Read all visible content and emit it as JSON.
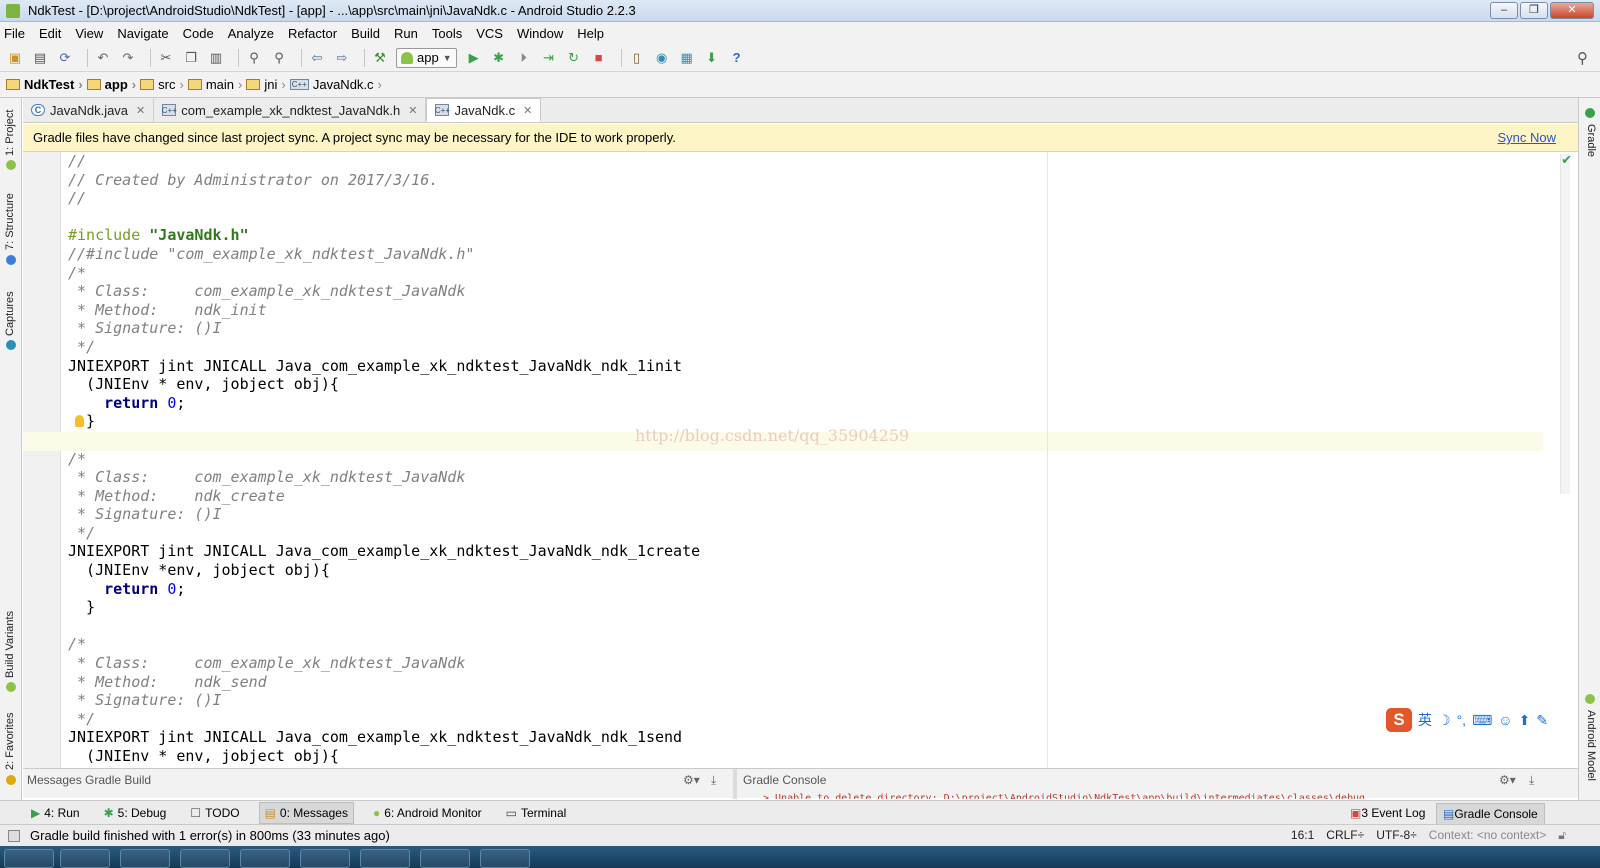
{
  "window": {
    "title": "NdkTest - [D:\\project\\AndroidStudio\\NdkTest] - [app] - ...\\app\\src\\main\\jni\\JavaNdk.c - Android Studio 2.2.3"
  },
  "menu": [
    "File",
    "Edit",
    "View",
    "Navigate",
    "Code",
    "Analyze",
    "Refactor",
    "Build",
    "Run",
    "Tools",
    "VCS",
    "Window",
    "Help"
  ],
  "toolbar": {
    "run_config": "app"
  },
  "breadcrumbs": [
    "NdkTest",
    "app",
    "src",
    "main",
    "jni",
    "JavaNdk.c"
  ],
  "left_tools": [
    "1: Project",
    "7: Structure",
    "Captures",
    "Build Variants",
    "2: Favorites"
  ],
  "right_tools": [
    "Gradle",
    "Android Model"
  ],
  "tabs": [
    {
      "label": "JavaNdk.java",
      "type": "java"
    },
    {
      "label": "com_example_xk_ndktest_JavaNdk.h",
      "type": "c"
    },
    {
      "label": "JavaNdk.c",
      "type": "c"
    }
  ],
  "notification": {
    "text": "Gradle files have changed since last project sync. A project sync may be necessary for the IDE to work properly.",
    "action": "Sync Now"
  },
  "code_lines": [
    [
      [
        "c-comment",
        "//"
      ]
    ],
    [
      [
        "c-comment",
        "// Created by Administrator on 2017/3/16."
      ]
    ],
    [
      [
        "c-comment",
        "//"
      ]
    ],
    [
      [
        "c-plain",
        ""
      ]
    ],
    [
      [
        "c-pre",
        "#include "
      ],
      [
        "c-str",
        "\"JavaNdk.h\""
      ]
    ],
    [
      [
        "c-comment",
        "//#include \"com_example_xk_ndktest_JavaNdk.h\""
      ]
    ],
    [
      [
        "c-comment",
        "/*"
      ]
    ],
    [
      [
        "c-comment",
        " * Class:     com_example_xk_ndktest_JavaNdk"
      ]
    ],
    [
      [
        "c-comment",
        " * Method:    ndk_init"
      ]
    ],
    [
      [
        "c-comment",
        " * Signature: ()I"
      ]
    ],
    [
      [
        "c-comment",
        " */"
      ]
    ],
    [
      [
        "c-plain",
        "JNIEXPORT jint JNICALL Java_com_example_xk_ndktest_JavaNdk_ndk_1init"
      ]
    ],
    [
      [
        "c-plain",
        "  (JNIEnv * env, jobject obj){"
      ]
    ],
    [
      [
        "c-plain",
        "    "
      ],
      [
        "c-kw",
        "return "
      ],
      [
        "c-num",
        "0"
      ],
      [
        "c-plain",
        ";"
      ]
    ],
    [
      [
        "c-plain",
        "  }"
      ]
    ],
    [
      [
        "c-plain",
        ""
      ]
    ],
    [
      [
        "c-comment",
        "/*"
      ]
    ],
    [
      [
        "c-comment",
        " * Class:     com_example_xk_ndktest_JavaNdk"
      ]
    ],
    [
      [
        "c-comment",
        " * Method:    ndk_create"
      ]
    ],
    [
      [
        "c-comment",
        " * Signature: ()I"
      ]
    ],
    [
      [
        "c-comment",
        " */"
      ]
    ],
    [
      [
        "c-plain",
        "JNIEXPORT jint JNICALL Java_com_example_xk_ndktest_JavaNdk_ndk_1create"
      ]
    ],
    [
      [
        "c-plain",
        "  (JNIEnv *env, jobject obj){"
      ]
    ],
    [
      [
        "c-plain",
        "    "
      ],
      [
        "c-kw",
        "return "
      ],
      [
        "c-num",
        "0"
      ],
      [
        "c-plain",
        ";"
      ]
    ],
    [
      [
        "c-plain",
        "  }"
      ]
    ],
    [
      [
        "c-plain",
        ""
      ]
    ],
    [
      [
        "c-comment",
        "/*"
      ]
    ],
    [
      [
        "c-comment",
        " * Class:     com_example_xk_ndktest_JavaNdk"
      ]
    ],
    [
      [
        "c-comment",
        " * Method:    ndk_send"
      ]
    ],
    [
      [
        "c-comment",
        " * Signature: ()I"
      ]
    ],
    [
      [
        "c-comment",
        " */"
      ]
    ],
    [
      [
        "c-plain",
        "JNIEXPORT jint JNICALL Java_com_example_xk_ndktest_JavaNdk_ndk_1send"
      ]
    ],
    [
      [
        "c-plain",
        "  (JNIEnv * env, jobject obj){"
      ]
    ]
  ],
  "watermark": "http://blog.csdn.net/qq_35904259",
  "ime": {
    "label": "英"
  },
  "panels": {
    "messages": "Messages Gradle Build",
    "gradle_console": "Gradle Console",
    "console_error": "> Unable to delete directory: D:\\project\\AndroidStudio\\NdkTest\\app\\build\\intermediates\\classes\\debug"
  },
  "bottom_tabs": [
    "4: Run",
    "5: Debug",
    "TODO",
    "0: Messages",
    "6: Android Monitor",
    "Terminal"
  ],
  "bottom_right_tabs": [
    "3 Event Log",
    "Gradle Console"
  ],
  "status": {
    "message": "Gradle build finished with 1 error(s) in 800ms (33 minutes ago)",
    "position": "16:1",
    "line_sep": "CRLF÷",
    "encoding": "UTF-8÷",
    "context": "Context: <no context>"
  }
}
